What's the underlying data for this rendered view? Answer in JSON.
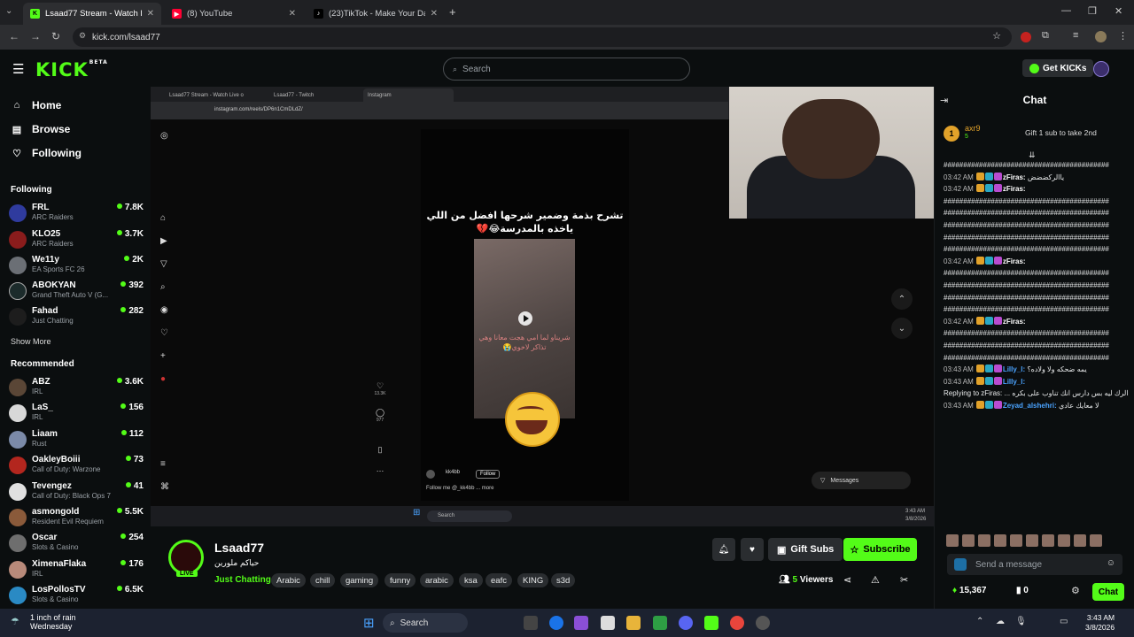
{
  "browser": {
    "tabs": [
      {
        "title": "Lsaad77 Stream - Watch Liv...",
        "icon": "kick-icon",
        "active": true
      },
      {
        "title": "(8) YouTube",
        "icon": "youtube-icon"
      },
      {
        "title": "(23)TikTok - Make Your Day",
        "icon": "tiktok-icon"
      }
    ],
    "url": "kick.com/lsaad77"
  },
  "header": {
    "logo": "KICK",
    "logo_badge": "BETA",
    "search_placeholder": "Search",
    "get_kicks": "Get KICKs"
  },
  "sidebar": {
    "nav": [
      {
        "label": "Home"
      },
      {
        "label": "Browse"
      },
      {
        "label": "Following"
      }
    ],
    "following_title": "Following",
    "following": [
      {
        "name": "FRL",
        "game": "ARC Raiders",
        "viewers": "7.8K"
      },
      {
        "name": "KLO25",
        "game": "ARC Raiders",
        "viewers": "3.7K"
      },
      {
        "name": "We11y",
        "game": "EA Sports FC 26",
        "viewers": "2K"
      },
      {
        "name": "ABOKYAN",
        "game": "Grand Theft Auto V (G...",
        "viewers": "392"
      },
      {
        "name": "Fahad",
        "game": "Just Chatting",
        "viewers": "282"
      }
    ],
    "show_more": "Show More",
    "recommended_title": "Recommended",
    "recommended": [
      {
        "name": "ABZ",
        "game": "IRL",
        "viewers": "3.6K"
      },
      {
        "name": "LaS_",
        "game": "IRL",
        "viewers": "156"
      },
      {
        "name": "Liaam",
        "game": "Rust",
        "viewers": "112"
      },
      {
        "name": "OakleyBoiii",
        "game": "Call of Duty: Warzone",
        "viewers": "73"
      },
      {
        "name": "Tevengez",
        "game": "Call of Duty: Black Ops 7",
        "viewers": "41"
      },
      {
        "name": "asmongold",
        "game": "Resident Evil Requiem",
        "viewers": "5.5K"
      },
      {
        "name": "Oscar",
        "game": "Slots & Casino",
        "viewers": "254"
      },
      {
        "name": "XimenaFlaka",
        "game": "IRL",
        "viewers": "176"
      },
      {
        "name": "LosPollosTV",
        "game": "Slots & Casino",
        "viewers": "6.5K"
      }
    ]
  },
  "stream_capture": {
    "inner_tabs": [
      "Lsaad77 Stream - Watch Live o",
      "Lsaad77 - Twitch",
      "Instagram"
    ],
    "inner_url": "instagram.com/reels/DP6n1CmDLdZ/",
    "reel_caption": "تشرح بذمة وضمير شرحها افضل من اللي ياخذه بالمدرسة😂💔",
    "clip_caption": "شريناو لما امي هجت معانا وهي تذاكر لاخوي😭",
    "reel_user": "kk4bb",
    "follow": "Follow",
    "reel_footer": "Follow me @_kk4bb ... more",
    "likes": "13.3K",
    "comments": "977",
    "messages": "Messages",
    "inner_search": "Search",
    "inner_time": "3:43 AM",
    "inner_date": "3/8/2026"
  },
  "stream_info": {
    "name": "Lsaad77",
    "title": "حياكم ملورين",
    "live": "LIVE",
    "category": "Just Chatting",
    "tags": [
      "Arabic",
      "chill",
      "gaming",
      "funny",
      "arabic",
      "ksa",
      "eafc",
      "KING",
      "s3d"
    ],
    "gift_subs": "Gift Subs",
    "subscribe": "Subscribe",
    "viewers_count": "5",
    "viewers_label": "Viewers"
  },
  "chat": {
    "title": "Chat",
    "pinned": {
      "rank": "1",
      "user": "axr9",
      "subs": "5",
      "gift_text": "Gift 1 sub to take 2nd"
    },
    "messages": [
      {
        "time": "",
        "user": "",
        "text": "##########################################"
      },
      {
        "time": "03:42 AM",
        "user": "zFiras:",
        "text": "ياالركضضض"
      },
      {
        "time": "03:42 AM",
        "user": "zFiras:",
        "text": ""
      },
      {
        "time": "",
        "user": "",
        "text": "##########################################"
      },
      {
        "time": "",
        "user": "",
        "text": "##########################################"
      },
      {
        "time": "",
        "user": "",
        "text": "##########################################"
      },
      {
        "time": "",
        "user": "",
        "text": "##########################################"
      },
      {
        "time": "",
        "user": "",
        "text": "##########################################"
      },
      {
        "time": "03:42 AM",
        "user": "zFiras:",
        "text": ""
      },
      {
        "time": "",
        "user": "",
        "text": "##########################################"
      },
      {
        "time": "",
        "user": "",
        "text": "##########################################"
      },
      {
        "time": "",
        "user": "",
        "text": "##########################################"
      },
      {
        "time": "",
        "user": "",
        "text": "##########################################"
      },
      {
        "time": "03:42 AM",
        "user": "zFiras:",
        "text": ""
      },
      {
        "time": "",
        "user": "",
        "text": "##########################################"
      },
      {
        "time": "",
        "user": "",
        "text": "##########################################"
      },
      {
        "time": "",
        "user": "",
        "text": "##########################################"
      },
      {
        "time": "",
        "user": "",
        "text": ""
      },
      {
        "time": "03:43 AM",
        "user": "Lilly_l:",
        "text": "يمه ضحكه ولا ولاده؟"
      },
      {
        "time": "03:43 AM",
        "user": "Lilly_l:",
        "text": ""
      },
      {
        "time": "",
        "user": "",
        "text": "Replying to zFiras: ... الرك ليه بس دارس انك تناوب على بكره"
      },
      {
        "time": "03:43 AM",
        "user": "Zeyad_alshehri:",
        "text": "لا معايك عادي"
      }
    ],
    "send_placeholder": "Send a message",
    "points": "15,367",
    "zero": "0",
    "chat_button": "Chat"
  },
  "taskbar": {
    "weather_line1": "1 inch of rain",
    "weather_line2": "Wednesday",
    "search": "Search",
    "time": "3:43 AM",
    "date": "3/8/2026"
  },
  "colors": {
    "accent": "#53fc18",
    "background": "#0b0e0f"
  }
}
